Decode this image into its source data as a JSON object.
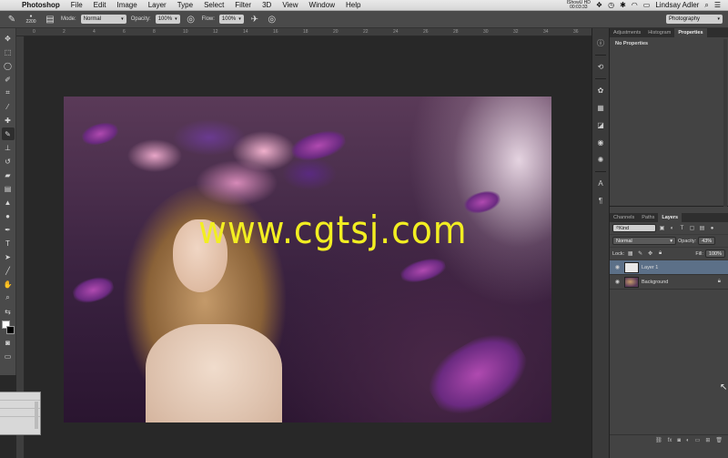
{
  "menubar": {
    "apple": "",
    "app_name": "Photoshop",
    "items": [
      "File",
      "Edit",
      "Image",
      "Layer",
      "Type",
      "Select",
      "Filter",
      "3D",
      "View",
      "Window",
      "Help"
    ],
    "recorder_line1": "IShowU HD",
    "recorder_line2": "00:03:33",
    "user": "Lindsay Adler"
  },
  "options": {
    "brush_size": "2200",
    "mode_label": "Mode:",
    "mode_value": "Normal",
    "opacity_label": "Opacity:",
    "opacity_value": "100%",
    "flow_label": "Flow:",
    "flow_value": "100%",
    "workspace": "Photography"
  },
  "ruler": {
    "ticks": [
      "0",
      "2",
      "4",
      "6",
      "8",
      "10",
      "12",
      "14",
      "16",
      "18",
      "20",
      "22",
      "24",
      "26",
      "28",
      "30",
      "32",
      "34",
      "36"
    ]
  },
  "watermark": "www.cgtsj.com",
  "properties_panel": {
    "tabs": [
      "Adjustments",
      "Histogram",
      "Properties"
    ],
    "title": "No Properties"
  },
  "layers_panel": {
    "tabs": [
      "Channels",
      "Paths",
      "Layers"
    ],
    "filter_kind": "Kind",
    "blend_mode": "Normal",
    "opacity_label": "Opacity:",
    "opacity_value": "43%",
    "lock_label": "Lock:",
    "fill_label": "Fill:",
    "fill_value": "100%",
    "layers": [
      {
        "name": "Layer 1"
      },
      {
        "name": "Background"
      }
    ]
  }
}
